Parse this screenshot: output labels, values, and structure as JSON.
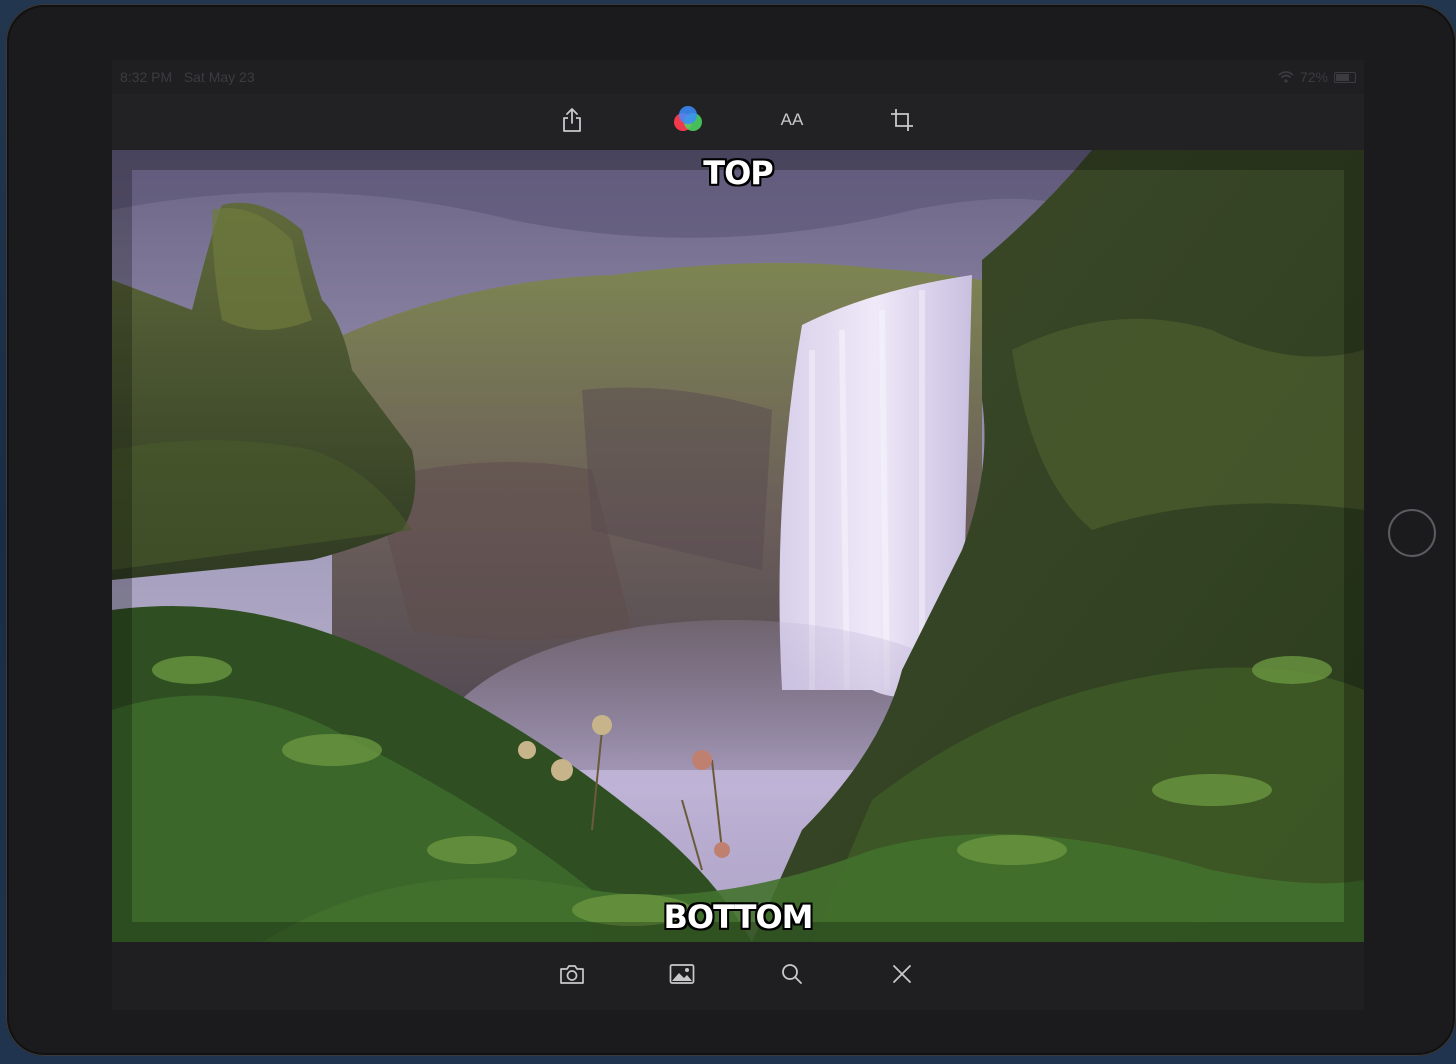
{
  "status": {
    "time": "8:32 PM",
    "date": "Sat May 23",
    "battery": "72%"
  },
  "top_toolbar": {
    "buttons": [
      {
        "name": "share",
        "icon": "share-icon"
      },
      {
        "name": "filters",
        "icon": "color-filter-icon"
      },
      {
        "name": "text-size",
        "icon": "text-size-icon",
        "label": "AA"
      },
      {
        "name": "crop",
        "icon": "crop-icon"
      }
    ]
  },
  "meme": {
    "top_text": "TOP",
    "bottom_text": "BOTTOM"
  },
  "bottom_toolbar": {
    "buttons": [
      {
        "name": "camera",
        "icon": "camera-icon"
      },
      {
        "name": "photo-library",
        "icon": "photo-icon"
      },
      {
        "name": "search",
        "icon": "search-icon"
      },
      {
        "name": "close",
        "icon": "close-icon"
      }
    ]
  },
  "colors": {
    "filter_red": "#ff3b4e",
    "filter_green": "#4cd964",
    "filter_blue": "#3a8dff"
  }
}
